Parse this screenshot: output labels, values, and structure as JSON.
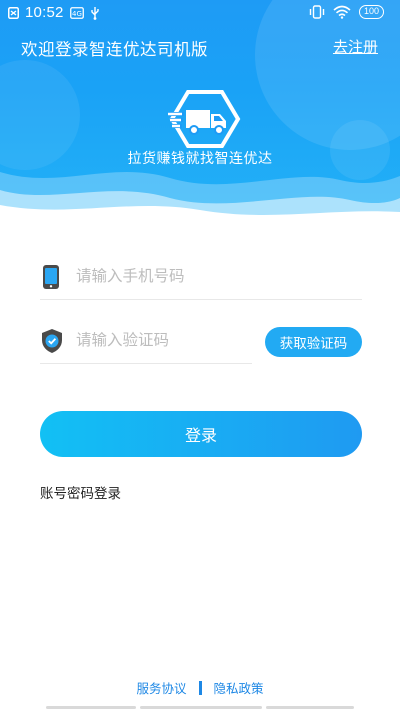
{
  "status_bar": {
    "time": "10:52",
    "battery": "100",
    "icons": [
      "notification-icon",
      "hd-icon",
      "usb-icon",
      "vibrate-icon",
      "wifi-icon",
      "battery-icon"
    ]
  },
  "header": {
    "title": "欢迎登录智连优达司机版",
    "register_link": "去注册",
    "slogan": "拉货赚钱就找智连优达"
  },
  "form": {
    "phone": {
      "placeholder": "请输入手机号码",
      "value": ""
    },
    "code": {
      "placeholder": "请输入验证码",
      "value": ""
    },
    "get_code_label": "获取验证码",
    "login_label": "登录",
    "alt_login_label": "账号密码登录"
  },
  "footer": {
    "service_agreement": "服务协议",
    "privacy_policy": "隐私政策"
  },
  "colors": {
    "brand_blue": "#1e9bf5",
    "button_blue": "#22aaf3",
    "link_blue": "#1e88e5"
  }
}
